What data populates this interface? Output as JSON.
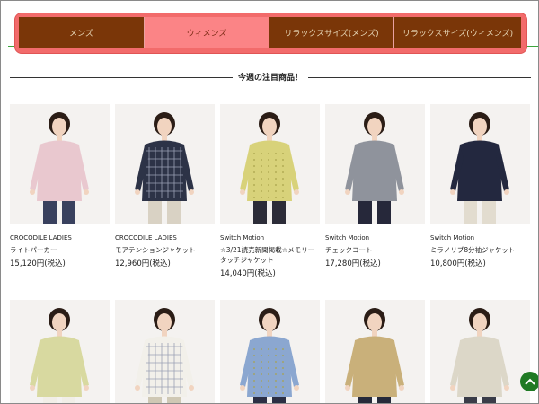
{
  "nav": {
    "tabs": [
      {
        "label": "メンズ",
        "active": false
      },
      {
        "label": "ウィメンズ",
        "active": true
      },
      {
        "label": "リラックスサイズ(メンズ)",
        "active": false
      },
      {
        "label": "リラックスサイズ(ウィメンズ)",
        "active": false
      }
    ]
  },
  "section": {
    "title": "今週の注目商品！"
  },
  "products_row1": [
    {
      "brand": "CROCODILE LADIES",
      "name": "ライトパーカー",
      "price": "15,120円(税込)",
      "garment_color": "#e9c8cf",
      "pants_color": "#39415e",
      "icon": "light-parka-photo"
    },
    {
      "brand": "CROCODILE LADIES",
      "name": "モアテンションジャケット",
      "price": "12,960円(税込)",
      "garment_color": "#2d3347",
      "pants_color": "#d9d2c4",
      "icon": "plaid-jacket-photo"
    },
    {
      "brand": "Switch Motion",
      "name": "☆3/21読売新聞掲載☆メモリータッチジャケット",
      "price": "14,040円(税込)",
      "garment_color": "#d8d27a",
      "pants_color": "#2c2c38",
      "icon": "memory-touch-jacket-photo"
    },
    {
      "brand": "Switch Motion",
      "name": "チェックコート",
      "price": "17,280円(税込)",
      "garment_color": "#8f939c",
      "pants_color": "#26283a",
      "icon": "check-coat-photo"
    },
    {
      "brand": "Switch Motion",
      "name": "ミラノリブ8分袖ジャケット",
      "price": "10,800円(税込)",
      "garment_color": "#23283f",
      "pants_color": "#e2dccf",
      "icon": "milano-rib-jacket-photo"
    }
  ],
  "products_row2": [
    {
      "garment_color": "#d8d9a0",
      "pants_color": "#f1eee7",
      "icon": "striped-top-photo"
    },
    {
      "garment_color": "#f2f0ea",
      "pants_color": "#cfc8b4",
      "icon": "white-shirt-photo"
    },
    {
      "garment_color": "#8ba7d0",
      "pants_color": "#2b2f44",
      "icon": "blue-jacket-photo"
    },
    {
      "garment_color": "#c9b07a",
      "pants_color": "#262a3a",
      "icon": "trench-coat-photo"
    },
    {
      "garment_color": "#dcd7c8",
      "pants_color": "#3a3c48",
      "icon": "beige-coat-photo"
    }
  ]
}
